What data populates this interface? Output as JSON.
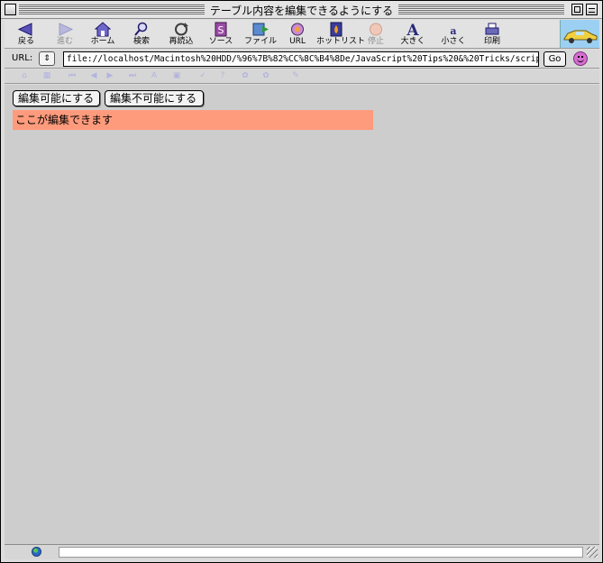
{
  "window": {
    "title": "テーブル内容を編集できるようにする"
  },
  "toolbar": {
    "items": [
      {
        "label": "戻る",
        "icon": "back-arrow-icon",
        "enabled": true
      },
      {
        "label": "進む",
        "icon": "forward-arrow-icon",
        "enabled": false
      },
      {
        "label": "ホーム",
        "icon": "home-icon",
        "enabled": true
      },
      {
        "label": "検索",
        "icon": "search-icon",
        "enabled": true
      },
      {
        "label": "再読込",
        "icon": "reload-icon",
        "enabled": true
      },
      {
        "label": "ソース",
        "icon": "source-icon",
        "enabled": true
      },
      {
        "label": "ファイル",
        "icon": "file-icon",
        "enabled": true
      },
      {
        "label": "URL",
        "icon": "url-globe-icon",
        "enabled": true
      },
      {
        "label": "ホットリスト",
        "icon": "hotlist-icon",
        "enabled": true
      },
      {
        "label": "停止",
        "icon": "stop-icon",
        "enabled": false
      },
      {
        "label": "大きく",
        "icon": "text-larger-icon",
        "enabled": true
      },
      {
        "label": "小さく",
        "icon": "text-smaller-icon",
        "enabled": true
      },
      {
        "label": "印刷",
        "icon": "print-icon",
        "enabled": true
      }
    ]
  },
  "urlbar": {
    "label": "URL:",
    "value": "file://localhost/Macintosh%20HDD/%96%7B%82%CC%8C%B4%8De/JavaScript%20Tips%20&%20Tricks/scrip",
    "go_label": "Go"
  },
  "content": {
    "buttons": {
      "make_editable": "編集可能にする",
      "make_not_editable": "編集不可能にする"
    },
    "editable_text": "ここが編集できます"
  },
  "colors": {
    "editable_background": "#ff9b7d",
    "content_background": "#cdcdcd"
  }
}
